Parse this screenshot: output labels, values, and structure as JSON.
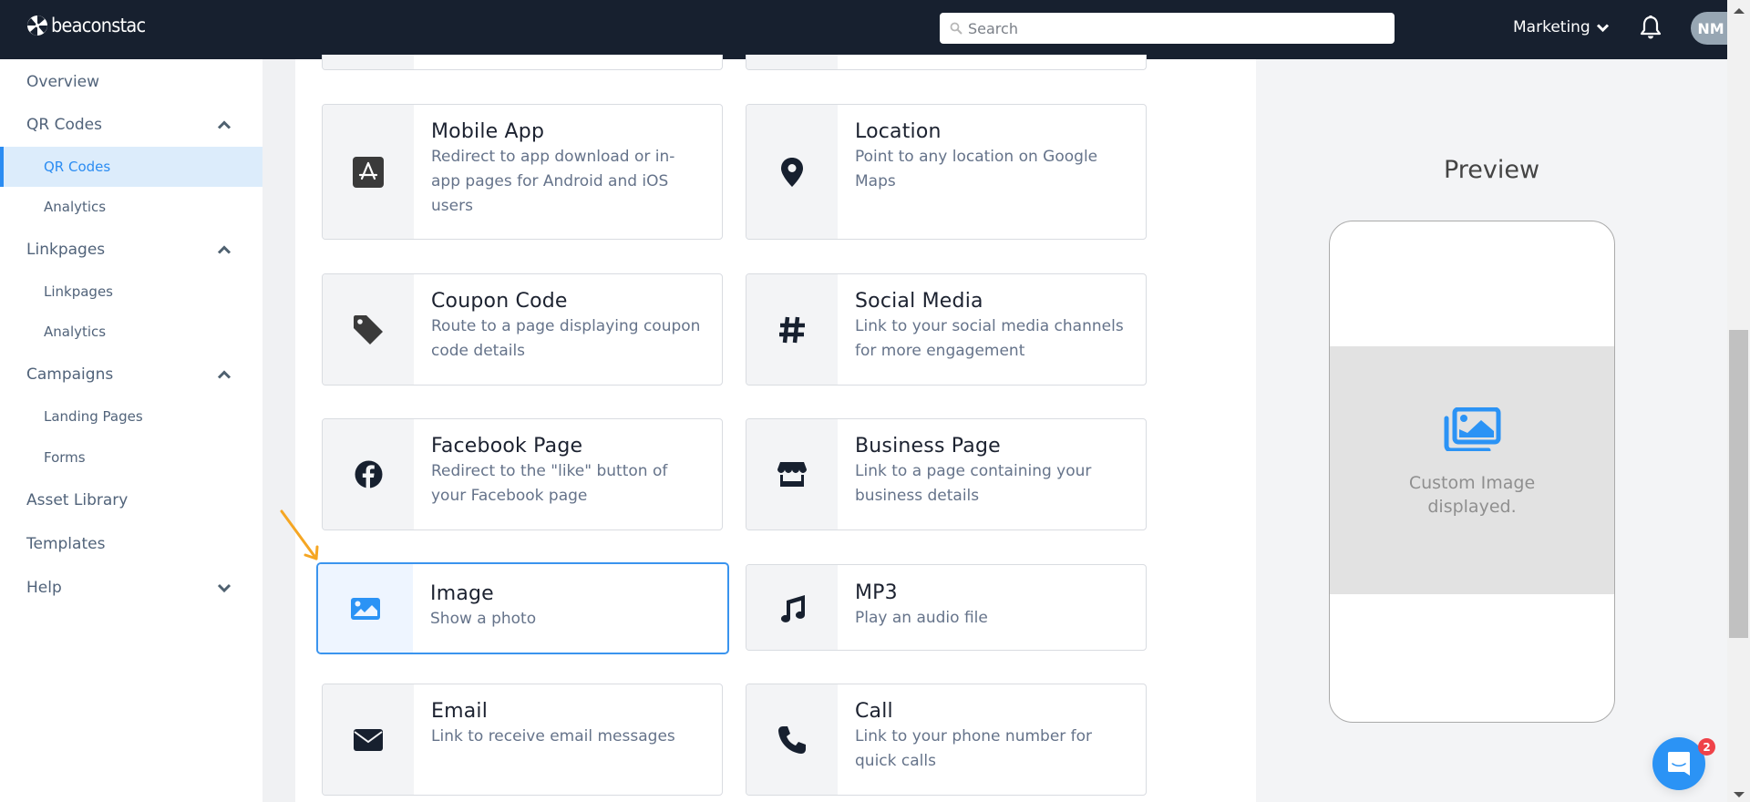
{
  "header": {
    "brand": "beaconstac",
    "search_placeholder": "Search",
    "organization": "Marketing",
    "avatar_initials": "NM"
  },
  "sidebar": {
    "items": [
      {
        "label": "Overview",
        "level": "top"
      },
      {
        "label": "QR Codes",
        "level": "top",
        "chevron": "up"
      },
      {
        "label": "QR Codes",
        "level": "sub",
        "active": true
      },
      {
        "label": "Analytics",
        "level": "sub"
      },
      {
        "label": "Linkpages",
        "level": "top",
        "chevron": "up"
      },
      {
        "label": "Linkpages",
        "level": "sub"
      },
      {
        "label": "Analytics",
        "level": "sub"
      },
      {
        "label": "Campaigns",
        "level": "top",
        "chevron": "up"
      },
      {
        "label": "Landing Pages",
        "level": "sub"
      },
      {
        "label": "Forms",
        "level": "sub"
      },
      {
        "label": "Asset Library",
        "level": "top"
      },
      {
        "label": "Templates",
        "level": "top"
      },
      {
        "label": "Help",
        "level": "top",
        "chevron": "down"
      }
    ]
  },
  "cards": [
    {
      "title": "Mobile App",
      "description": "Redirect to app download or in-app pages for Android and iOS users",
      "icon": "app-store-icon"
    },
    {
      "title": "Location",
      "description": "Point to any location on Google Maps",
      "icon": "map-pin-icon"
    },
    {
      "title": "Coupon Code",
      "description": "Route to a page displaying coupon code details",
      "icon": "tag-icon"
    },
    {
      "title": "Social Media",
      "description": "Link to your social media channels for more engagement",
      "icon": "hashtag-icon"
    },
    {
      "title": "Facebook Page",
      "description": "Redirect to the \"like\" button of your Facebook page",
      "icon": "facebook-icon"
    },
    {
      "title": "Business Page",
      "description": "Link to a page containing your business details",
      "icon": "store-icon"
    },
    {
      "title": "Image",
      "description": "Show a photo",
      "icon": "image-icon",
      "selected": true
    },
    {
      "title": "MP3",
      "description": "Play an audio file",
      "icon": "music-note-icon"
    },
    {
      "title": "Email",
      "description": "Link to receive email messages",
      "icon": "envelope-icon"
    },
    {
      "title": "Call",
      "description": "Link to your phone number for quick calls",
      "icon": "phone-icon"
    }
  ],
  "preview": {
    "title": "Preview",
    "caption_line1": "Custom Image",
    "caption_line2": "displayed."
  },
  "chat": {
    "badge_count": "2"
  },
  "colors": {
    "header_bg": "#17202f",
    "accent": "#2b8cf2",
    "active_bg": "#dcecfb",
    "badge": "#ef4249",
    "annotation_arrow": "#f5a623"
  }
}
